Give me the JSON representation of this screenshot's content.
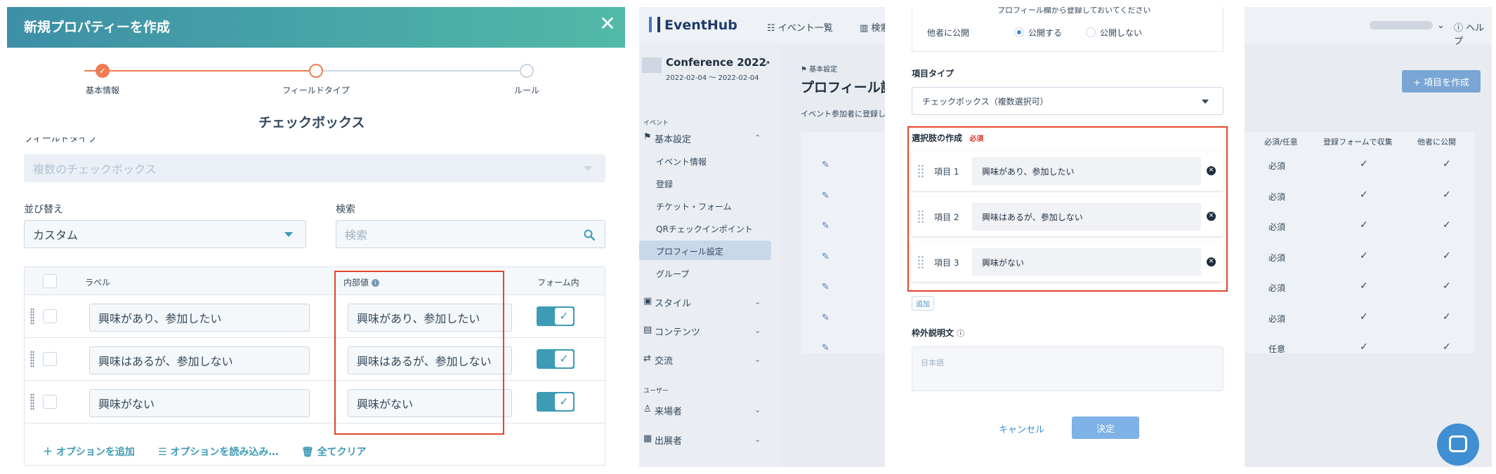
{
  "left": {
    "header_title": "新規プロパティーを作成",
    "close_symbol": "✕",
    "steps": [
      {
        "label": "基本情報",
        "state": "done"
      },
      {
        "label": "フィールドタイプ",
        "state": "current"
      },
      {
        "label": "ルール",
        "state": "todo"
      }
    ],
    "section_title": "チェックボックス",
    "field_type_label": "フィールドタイプ",
    "field_type_value": "複数のチェックボックス",
    "sort_label": "並び替え",
    "sort_value": "カスタム",
    "search_label": "検索",
    "search_placeholder": "検索",
    "table": {
      "col_label": "ラベル",
      "col_internal": "内部値",
      "col_form": "フォーム内",
      "rows": [
        {
          "label": "興味があり、参加したい",
          "internal": "興味があり、参加したい",
          "in_form": true
        },
        {
          "label": "興味はあるが、参加しない",
          "internal": "興味はあるが、参加しない",
          "in_form": true
        },
        {
          "label": "興味がない",
          "internal": "興味がない",
          "in_form": true
        }
      ],
      "add_option": "オプションを追加",
      "load_options": "オプションを読み込み…",
      "clear_all": "全てクリア"
    },
    "colors": {
      "accent": "#3d9bb5",
      "step": "#f07c52",
      "highlight": "#e2452c"
    }
  },
  "right": {
    "brand": "EventHub",
    "nav_events": "イベント一覧",
    "nav_search": "検索",
    "help": "ヘルプ",
    "event_name": "Conference 2022",
    "event_date": "2022-02-04 ～ 2022-02-04",
    "sidebar": {
      "section_event": "イベント",
      "basic_settings": "基本設定",
      "sub_items": [
        "イベント情報",
        "登録",
        "チケット・フォーム",
        "QRチェックインポイント",
        "プロフィール設定",
        "グループ"
      ],
      "active_item": "プロフィール設定",
      "style": "スタイル",
      "contents": "コンテンツ",
      "exchange": "交流",
      "section_user": "ユーザー",
      "visitors": "来場者",
      "exhibitors": "出展者"
    },
    "page": {
      "crumb": "基本設定",
      "title": "プロフィール設定",
      "desc": "イベント参加者に登録し",
      "add_item_button": "+ 項目を作成",
      "col_required": "必須/任意",
      "col_collect": "登録フォームで収集",
      "col_public": "他者に公開",
      "rows": [
        {
          "required": "必須",
          "collect": true,
          "public": true
        },
        {
          "required": "必須",
          "collect": true,
          "public": true
        },
        {
          "required": "必須",
          "collect": true,
          "public": true
        },
        {
          "required": "必須",
          "collect": true,
          "public": true
        },
        {
          "required": "必須",
          "collect": true,
          "public": true
        },
        {
          "required": "必須",
          "collect": true,
          "public": true
        },
        {
          "required": "任意",
          "collect": true,
          "public": true
        }
      ]
    },
    "modal": {
      "cut_text": "プロフィール欄から登録しておいてください",
      "public_label": "他者に公開",
      "public_yes": "公開する",
      "public_no": "公開しない",
      "item_type_label": "項目タイプ",
      "item_type_value": "チェックボックス（複数選択可）",
      "choices_label": "選択肢の作成",
      "required_badge": "必須",
      "choices": [
        {
          "label": "項目 1",
          "value": "興味があり、参加したい"
        },
        {
          "label": "項目 2",
          "value": "興味はあるが、参加しない"
        },
        {
          "label": "項目 3",
          "value": "興味がない"
        }
      ],
      "add_button": "追加",
      "outside_desc_label": "枠外説明文",
      "outside_desc_placeholder": "日本語",
      "cancel": "キャンセル",
      "confirm": "決定"
    }
  }
}
